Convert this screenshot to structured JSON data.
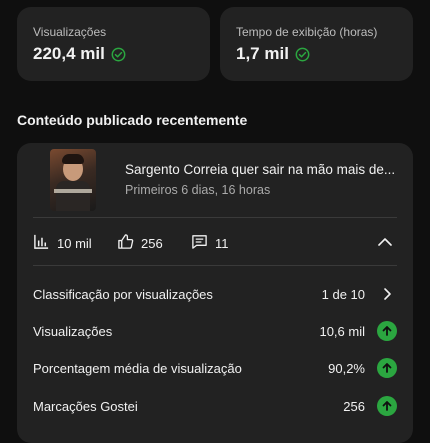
{
  "stats": [
    {
      "label": "Visualizações",
      "value": "220,4 mil"
    },
    {
      "label": "Tempo de exibição (horas)",
      "value": "1,7 mil"
    }
  ],
  "colors": {
    "accent_green": "#2ba640",
    "check_green": "#2ba640"
  },
  "section_title": "Conteúdo publicado recentemente",
  "video": {
    "title": "Sargento Correia quer sair na mão mais de...",
    "subtitle": "Primeiros 6 dias, 16 horas",
    "views": "10 mil",
    "likes": "256",
    "comments": "11"
  },
  "rows": [
    {
      "label": "Classificação por visualizações",
      "value": "1 de 10",
      "indicator": "chevron-right-icon"
    },
    {
      "label": "Visualizações",
      "value": "10,6 mil",
      "indicator": "arrow-up-icon"
    },
    {
      "label": "Porcentagem média de visualização",
      "value": "90,2%",
      "indicator": "arrow-up-icon"
    },
    {
      "label": "Marcações Gostei",
      "value": "256",
      "indicator": "arrow-up-icon"
    }
  ]
}
